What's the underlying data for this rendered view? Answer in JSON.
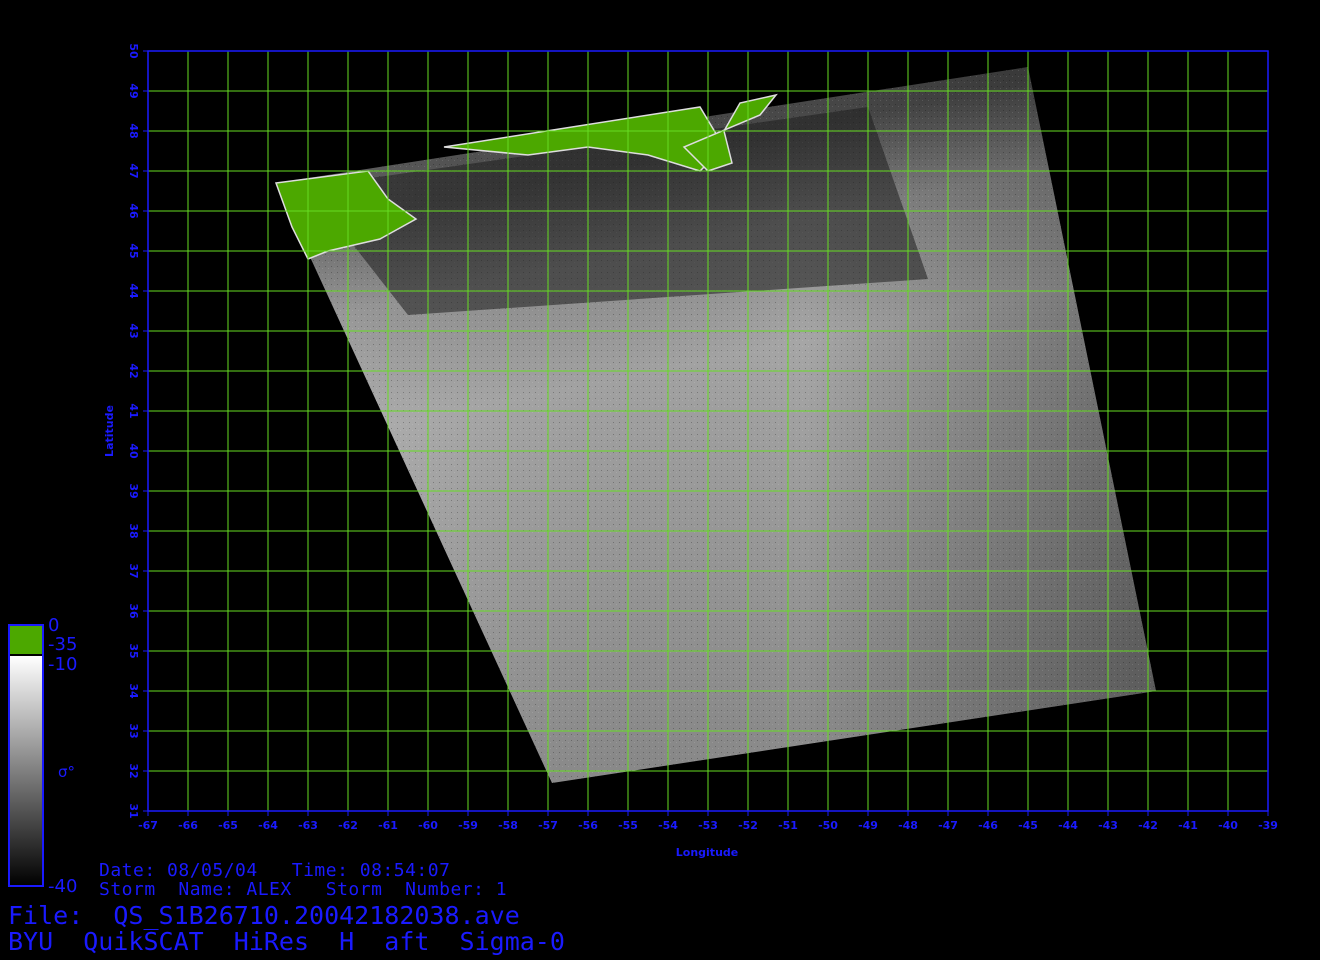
{
  "map": {
    "lon_range": [
      -67,
      -39
    ],
    "lat_range": [
      31,
      50
    ],
    "lon_ticks": [
      "-67",
      "-66",
      "-65",
      "-64",
      "-63",
      "-62",
      "-61",
      "-60",
      "-59",
      "-58",
      "-57",
      "-56",
      "-55",
      "-54",
      "-53",
      "-52",
      "-51",
      "-50",
      "-49",
      "-48",
      "-47",
      "-46",
      "-45",
      "-44",
      "-43",
      "-42",
      "-41",
      "-40",
      "-39"
    ],
    "lat_ticks": [
      "31",
      "32",
      "33",
      "34",
      "35",
      "36",
      "37",
      "38",
      "39",
      "40",
      "41",
      "42",
      "43",
      "44",
      "45",
      "46",
      "47",
      "48",
      "49",
      "50"
    ],
    "xlabel": "Longitude",
    "ylabel": "Latitude",
    "swath_corners_lonlat": [
      [
        -63.8,
        46.7
      ],
      [
        -45.0,
        49.6
      ],
      [
        -41.8,
        34.0
      ],
      [
        -56.9,
        31.7
      ]
    ],
    "colors": {
      "grid": "#66dd22",
      "axis_text": "#1a1aff",
      "land": "#4ca800",
      "background": "#000000"
    }
  },
  "colorbar": {
    "label_top": "0",
    "label_land": "-35",
    "label_mid": "-10",
    "label_bottom": "-40",
    "title": "σ°"
  },
  "info": {
    "date_line": "Date: 08/05/04   Time: 08:54:07",
    "storm_line": "Storm  Name: ALEX   Storm  Number: 1",
    "file_line": "File:  QS_S1B26710.20042182038.ave",
    "product_line": "BYU  QuikSCAT  HiRes  H  aft  Sigma-0"
  }
}
